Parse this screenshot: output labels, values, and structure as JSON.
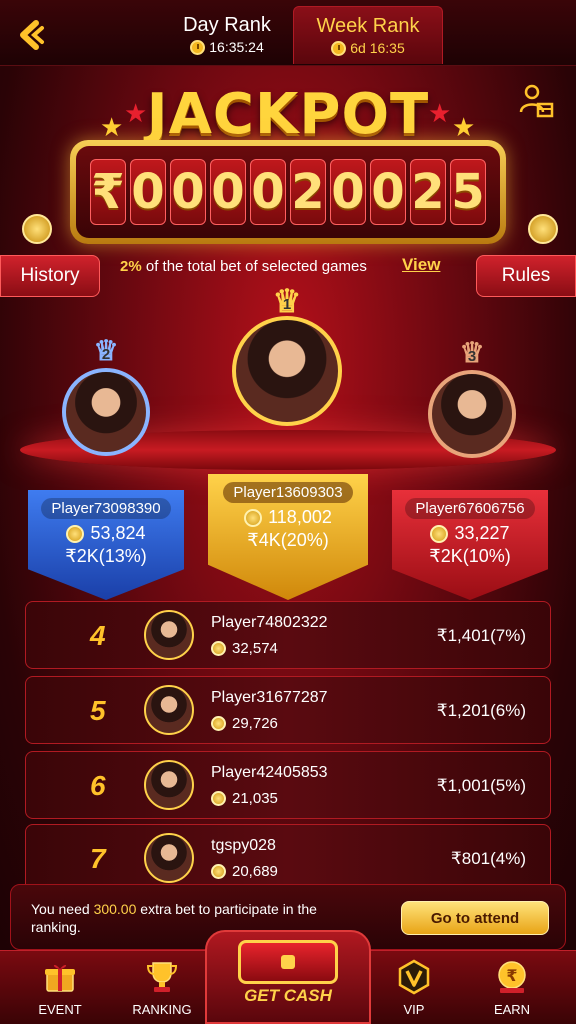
{
  "header": {
    "back_icon": "chevron-left-icon",
    "tabs": [
      {
        "label": "Day Rank",
        "time": "16:35:24",
        "active": false
      },
      {
        "label": "Week Rank",
        "time": "6d 16:35",
        "active": true
      }
    ]
  },
  "jackpot": {
    "title": "JACKPOT",
    "amount_chars": [
      "₹",
      "0",
      "0",
      "0",
      "0",
      "2",
      "0",
      "0",
      "2",
      "5"
    ],
    "pct": "2%",
    "pct_text": "of the total bet of selected games",
    "view_label": "View",
    "history_label": "History",
    "rules_label": "Rules",
    "share_icon": "users-gift-icon"
  },
  "podium": [
    {
      "rank": "2",
      "name": "Player73098390",
      "coins": "53,824",
      "prize": "₹2K(13%)",
      "color": "#2a5fd8"
    },
    {
      "rank": "1",
      "name": "Player13609303",
      "coins": "118,002",
      "prize": "₹4K(20%)",
      "color": "#e8a416"
    },
    {
      "rank": "3",
      "name": "Player67606756",
      "coins": "33,227",
      "prize": "₹2K(10%)",
      "color": "#c8202a"
    }
  ],
  "ranks": [
    {
      "rank": "4",
      "name": "Player74802322",
      "coins": "32,574",
      "prize": "₹1,401(7%)"
    },
    {
      "rank": "5",
      "name": "Player31677287",
      "coins": "29,726",
      "prize": "₹1,201(6%)"
    },
    {
      "rank": "6",
      "name": "Player42405853",
      "coins": "21,035",
      "prize": "₹1,001(5%)"
    },
    {
      "rank": "7",
      "name": "tgspy028",
      "coins": "20,689",
      "prize": "₹801(4%)"
    }
  ],
  "notice": {
    "prefix": "You need ",
    "amount": "300.00",
    "suffix": " extra bet to participate in the ranking.",
    "button": "Go to attend"
  },
  "nav": {
    "event": "EVENT",
    "ranking": "RANKING",
    "get_cash": "GET CASH",
    "vip": "VIP",
    "earn": "EARN"
  }
}
